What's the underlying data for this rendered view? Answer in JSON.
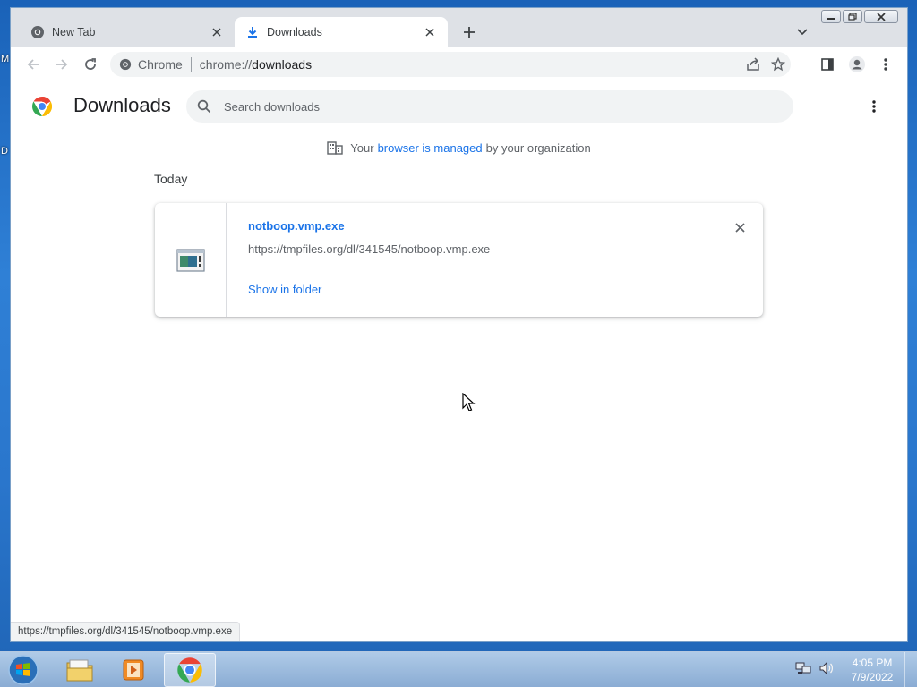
{
  "desktop": {
    "edge_labels": [
      "M",
      "D"
    ]
  },
  "tabs": [
    {
      "title": "New Tab",
      "icon": "chrome-icon"
    },
    {
      "title": "Downloads",
      "icon": "download-icon"
    }
  ],
  "toolbar": {
    "omnibox_origin": "Chrome",
    "url_scheme": "chrome://",
    "url_host": "downloads"
  },
  "downloads_page": {
    "title": "Downloads",
    "search_placeholder": "Search downloads",
    "managed_prefix": "Your",
    "managed_link": "browser is managed",
    "managed_suffix": "by your organization",
    "section_label": "Today",
    "item": {
      "file_name": "notboop.vmp.exe",
      "url": "https://tmpfiles.org/dl/341545/notboop.vmp.exe",
      "action": "Show in folder"
    }
  },
  "status_bar": "https://tmpfiles.org/dl/341545/notboop.vmp.exe",
  "taskbar": {
    "time": "4:05 PM",
    "date": "7/9/2022"
  },
  "colors": {
    "link": "#1a73e8",
    "tab_strip": "#dee1e6",
    "page_bg": "#ffffff"
  }
}
